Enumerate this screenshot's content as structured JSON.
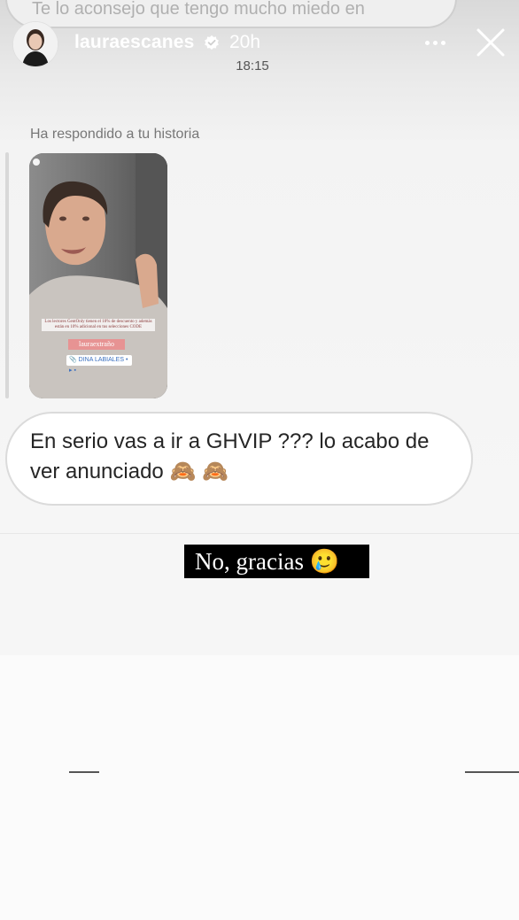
{
  "previous_message": {
    "text": "Te lo aconsejo que tengo mucho miedo en"
  },
  "header": {
    "username": "lauraescanes",
    "verified": true,
    "time_ago": "20h",
    "timestamp": "18:15",
    "more_icon": "more-horizontal-icon",
    "close_icon": "close-icon"
  },
  "reply": {
    "label": "Ha respondido a tu historia",
    "story_caption": "Los lectores GentOnly tienen el 10% de descuento y además están en 10% adicional en tus selecciones CODE",
    "story_handle": "lauraextraño",
    "story_tag": "📎 DINA LABIALES • ▸ ▪"
  },
  "message": {
    "text": "En serio vas a ir a GHVIP ??? lo acabo de ver anunciado 🙈 🙈"
  },
  "overlay": {
    "caption": "No, gracias 🥲"
  },
  "colors": {
    "bubble_border": "#dbdbdb",
    "text": "#262626",
    "caption_bg": "#000000",
    "verified": "#ffffff"
  }
}
